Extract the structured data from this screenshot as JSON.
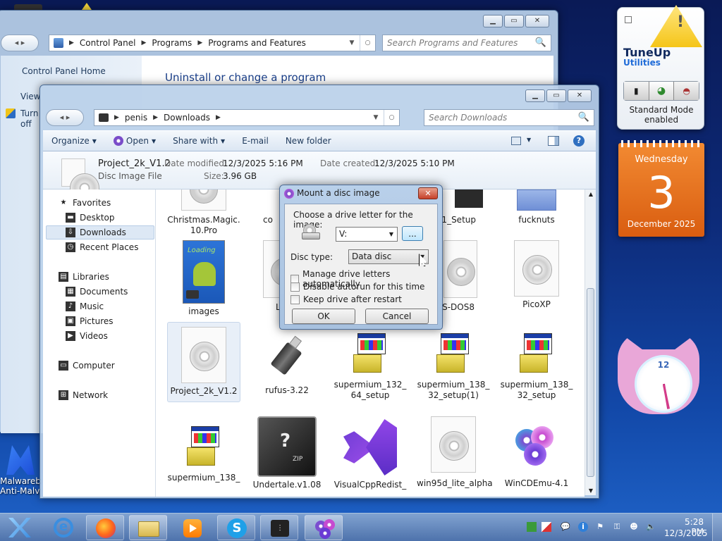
{
  "desktop": {
    "malwarebytes_label_1": "Malwareb",
    "malwarebytes_label_2": "Anti-Malv"
  },
  "cp_window": {
    "breadcrumb": [
      "Control Panel",
      "Programs",
      "Programs and Features"
    ],
    "search_placeholder": "Search Programs and Features",
    "sidebar_home": "Control Panel Home",
    "sidebar_view": "View",
    "sidebar_turn_1": "Turn",
    "sidebar_turn_2": "off",
    "heading": "Uninstall or change a program"
  },
  "explorer": {
    "breadcrumb": [
      "penis",
      "Downloads"
    ],
    "search_placeholder": "Search Downloads",
    "toolbar": {
      "organize": "Organize",
      "open": "Open",
      "share_with": "Share with",
      "email": "E-mail",
      "new_folder": "New folder"
    },
    "details": {
      "name": "Project_2k_V1.2",
      "type": "Disc Image File",
      "modified_label": "Date modified:",
      "modified_value": "12/3/2025 5:16 PM",
      "size_label": "Size:",
      "size_value": "3.96 GB",
      "created_label": "Date created:",
      "created_value": "12/3/2025 5:10 PM"
    },
    "nav": {
      "favorites": "Favorites",
      "desktop": "Desktop",
      "downloads": "Downloads",
      "recent": "Recent Places",
      "libraries": "Libraries",
      "documents": "Documents",
      "music": "Music",
      "pictures": "Pictures",
      "videos": "Videos",
      "computer": "Computer",
      "network": "Network"
    },
    "files": {
      "christmas_1": "Christmas.Magic.",
      "christmas_2": "10.Pro",
      "co": "co",
      "dx_setup": "X_11_Setup",
      "fucknuts": "fucknuts",
      "images": "images",
      "l_partial": "L",
      "msdos": "S-DOS8",
      "picoxp": "PicoXP",
      "project": "Project_2k_V1.2",
      "rufus": "rufus-3.22",
      "sup_132_1": "supermium_132_",
      "sup_132_2": "64_setup",
      "sup_138a_1": "supermium_138_",
      "sup_138a_2": "32_setup(1)",
      "sup_138b_1": "supermium_138_",
      "sup_138b_2": "32_setup",
      "sup_138c": "supermium_138_",
      "undertale": "Undertale.v1.08",
      "vcredist": "VisualCppRedist_",
      "win95": "win95d_lite_alpha",
      "wincdemu": "WinCDEmu-4.1"
    }
  },
  "dialog": {
    "title": "Mount a disc image",
    "choose_label": "Choose a drive letter for the image:",
    "drive_value": "V:",
    "browse_label": "...",
    "disc_type_label": "Disc type:",
    "disc_type_value": "Data disc",
    "opt_manage": "Manage drive letters automatically",
    "opt_autorun": "Disable autorun for this time",
    "opt_keep": "Keep drive after restart",
    "ok": "OK",
    "cancel": "Cancel"
  },
  "gadgets": {
    "tuneup_brand_1": "TuneUp",
    "tuneup_brand_2": "Utilities",
    "tuneup_status_1": "Standard Mode",
    "tuneup_status_2": "enabled",
    "cal_weekday": "Wednesday",
    "cal_day": "3",
    "cal_month": "December 2025",
    "clock_twelve": "12"
  },
  "taskbar": {
    "time": "5:28 PM",
    "date": "12/3/2025"
  },
  "colors": {
    "link_blue": "#1a3f8a",
    "calendar_orange": "#e8701f",
    "vs_purple": "#8b3ee0"
  }
}
